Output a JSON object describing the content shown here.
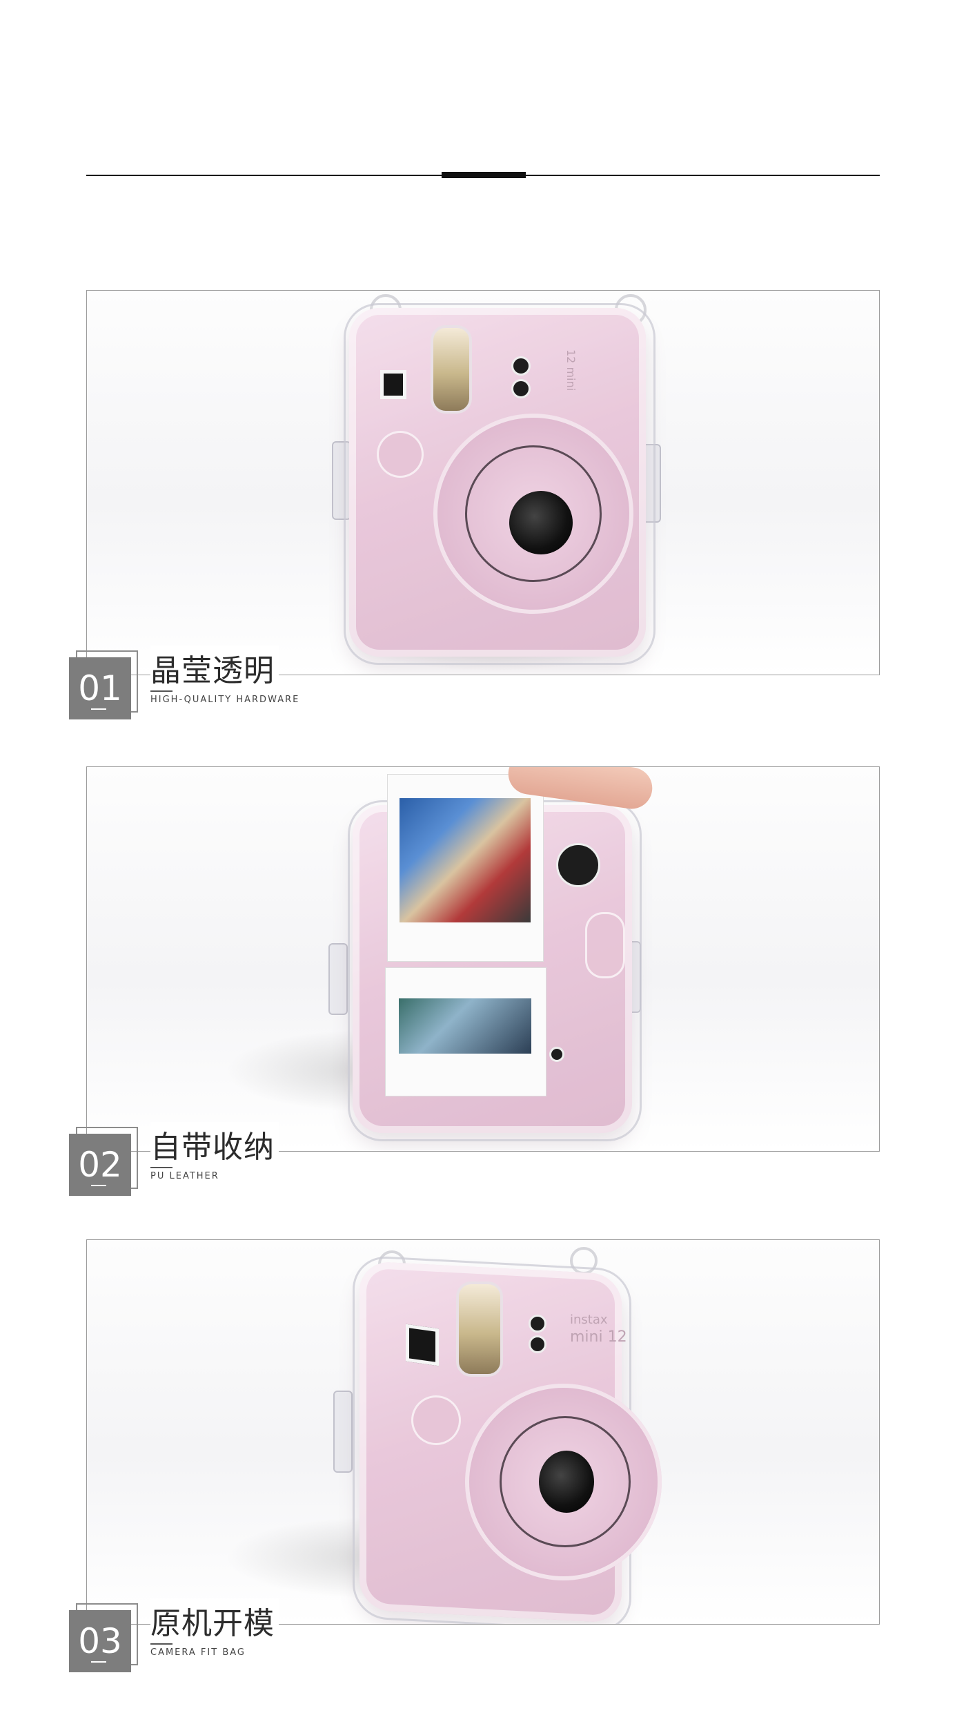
{
  "sections": [
    {
      "number": "01",
      "title": "晶莹透明",
      "subtitle": "HIGH-QUALITY HARDWARE"
    },
    {
      "number": "02",
      "title": "自带收纳",
      "subtitle": "PU LEATHER"
    },
    {
      "number": "03",
      "title": "原机开模",
      "subtitle": "CAMERA FIT BAG"
    }
  ],
  "camera": {
    "model_vertical": "12 mini",
    "brand": "instax",
    "model": "mini 12"
  },
  "colors": {
    "camera_pink": "#e6c1d6",
    "badge_gray": "#7d7d7d",
    "line": "#1a1a1a"
  }
}
